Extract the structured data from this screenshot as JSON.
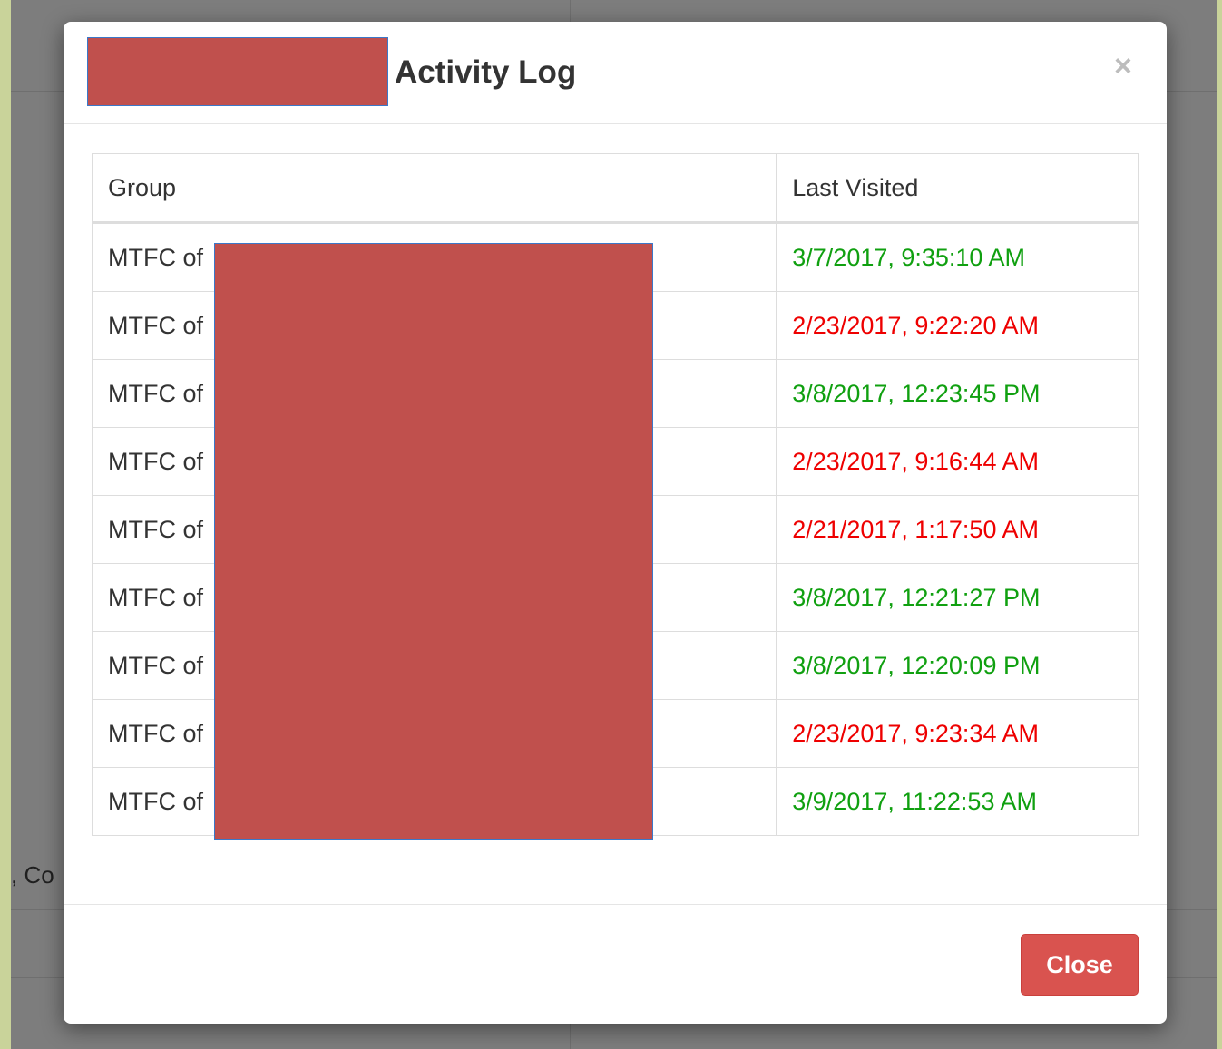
{
  "modal": {
    "title": "Activity Log",
    "close_icon": "×",
    "close_button_label": "Close"
  },
  "table": {
    "headers": [
      "Group",
      "Last Visited"
    ],
    "rows": [
      {
        "group": "MTFC of",
        "last_visited": "3/7/2017, 9:35:10 AM",
        "status": "green"
      },
      {
        "group": "MTFC of",
        "last_visited": "2/23/2017, 9:22:20 AM",
        "status": "red"
      },
      {
        "group": "MTFC of",
        "last_visited": "3/8/2017, 12:23:45 PM",
        "status": "green"
      },
      {
        "group": "MTFC of",
        "last_visited": "2/23/2017, 9:16:44 AM",
        "status": "red"
      },
      {
        "group": "MTFC of",
        "last_visited": "2/21/2017, 1:17:50 AM",
        "status": "red"
      },
      {
        "group": "MTFC of",
        "last_visited": "3/8/2017, 12:21:27 PM",
        "status": "green"
      },
      {
        "group": "MTFC of",
        "last_visited": "3/8/2017, 12:20:09 PM",
        "status": "green"
      },
      {
        "group": "MTFC of",
        "last_visited": "2/23/2017, 9:23:34 AM",
        "status": "red"
      },
      {
        "group": "MTFC of",
        "last_visited": "3/9/2017, 11:22:53 AM",
        "status": "green"
      }
    ]
  },
  "background": {
    "fragments": [
      ", Co"
    ]
  },
  "colors": {
    "recent": "#10a010",
    "stale": "#ee0000",
    "redaction": "#c0504d",
    "close_button": "#d9534f"
  }
}
